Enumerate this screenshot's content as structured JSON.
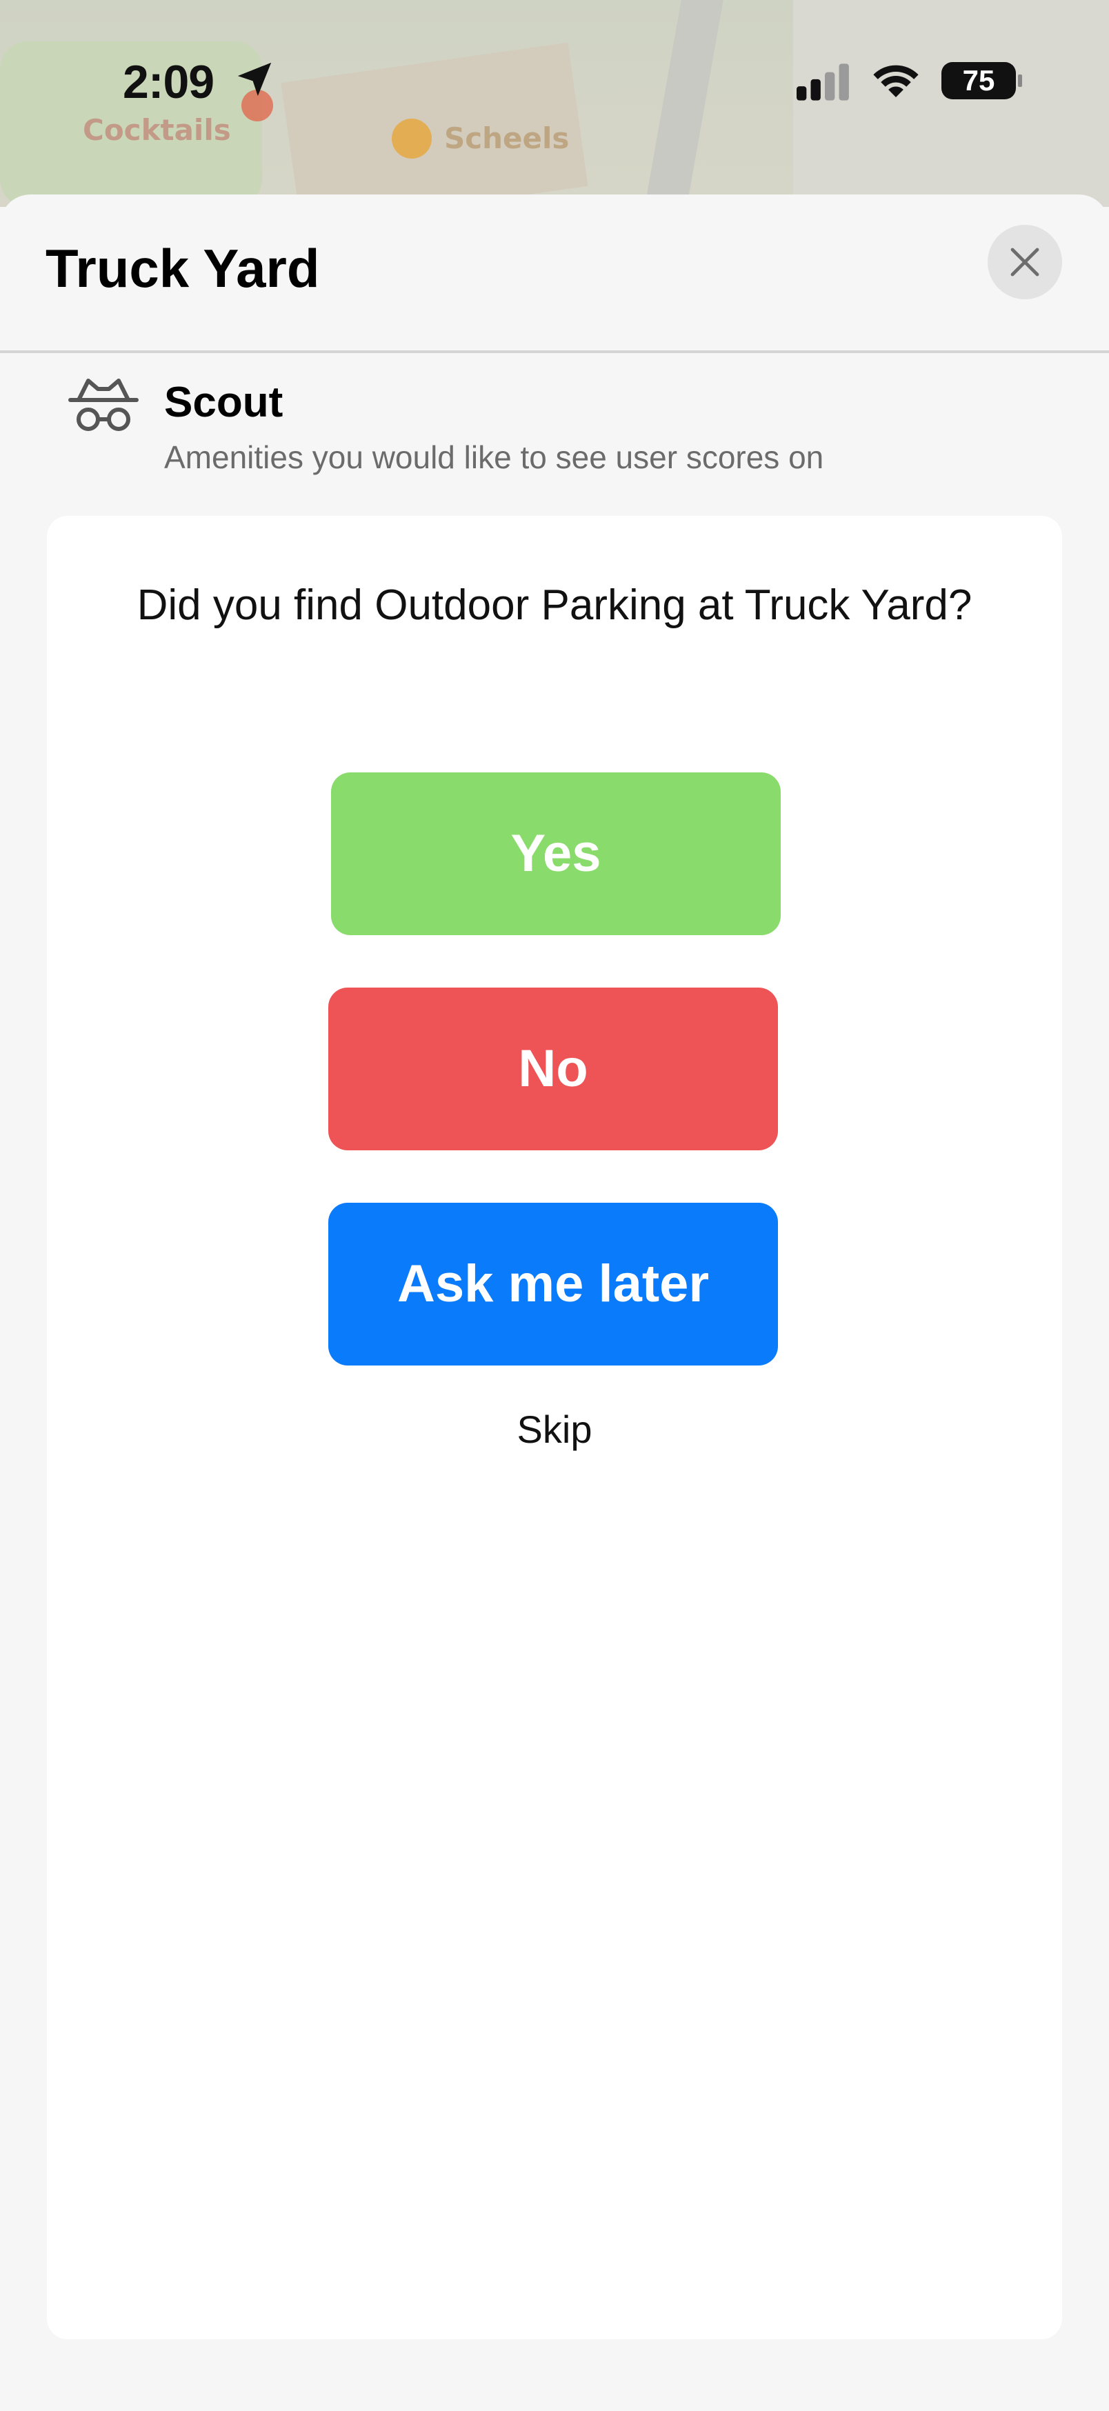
{
  "status_bar": {
    "time": "2:09",
    "battery": "75",
    "icons": [
      "location-arrow-icon",
      "cellular-signal-icon",
      "wifi-icon",
      "battery-icon"
    ]
  },
  "map": {
    "poi_scheels": "Scheels",
    "poi_cocktails": "Cocktails"
  },
  "sheet": {
    "title": "Truck Yard",
    "close_icon": "close-icon"
  },
  "scout": {
    "icon": "scout-incognito-icon",
    "title": "Scout",
    "subtitle": "Amenities you would like to see user scores on"
  },
  "prompt": {
    "question": "Did you find Outdoor Parking at Truck Yard?",
    "yes_label": "Yes",
    "no_label": "No",
    "later_label": "Ask me later",
    "skip_label": "Skip"
  },
  "colors": {
    "yes": "#89dc6c",
    "no": "#ee5355",
    "later": "#0a7bfb"
  }
}
